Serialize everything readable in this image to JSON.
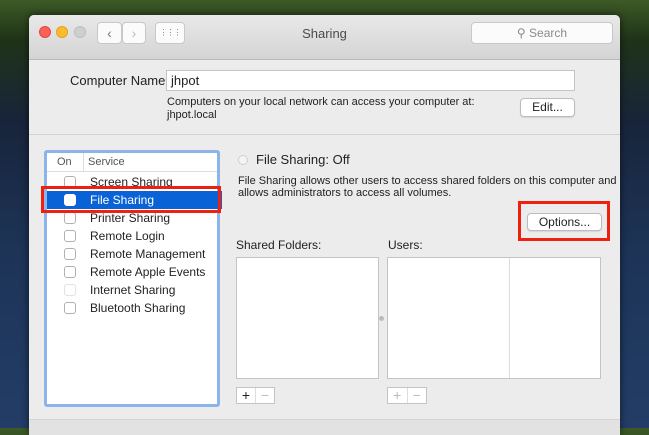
{
  "window": {
    "title": "Sharing",
    "search_placeholder": "Search",
    "back": "‹",
    "forward": "›",
    "grid": "⋮⋮⋮"
  },
  "computer_name": {
    "label": "Computer Name:",
    "value": "jhpot",
    "description": "Computers on your local network can access your computer at:",
    "address": "jhpot.local",
    "edit_label": "Edit..."
  },
  "services": {
    "col_on": "On",
    "col_service": "Service",
    "items": [
      {
        "label": "Screen Sharing",
        "checked": false
      },
      {
        "label": "File Sharing",
        "checked": false,
        "selected": true
      },
      {
        "label": "Printer Sharing",
        "checked": false
      },
      {
        "label": "Remote Login",
        "checked": false
      },
      {
        "label": "Remote Management",
        "checked": false
      },
      {
        "label": "Remote Apple Events",
        "checked": false
      },
      {
        "label": "Internet Sharing",
        "checked": false,
        "disabled": true
      },
      {
        "label": "Bluetooth Sharing",
        "checked": false
      }
    ]
  },
  "detail": {
    "status": "File Sharing: Off",
    "description_1": "File Sharing allows other users to access shared folders on this computer and",
    "description_2": "allows administrators to access all volumes.",
    "options_label": "Options...",
    "shared_folders_label": "Shared Folders:",
    "users_label": "Users:",
    "add": "+",
    "remove": "−"
  },
  "colors": {
    "selection": "#0a63d6",
    "highlight": "#f0200f"
  }
}
